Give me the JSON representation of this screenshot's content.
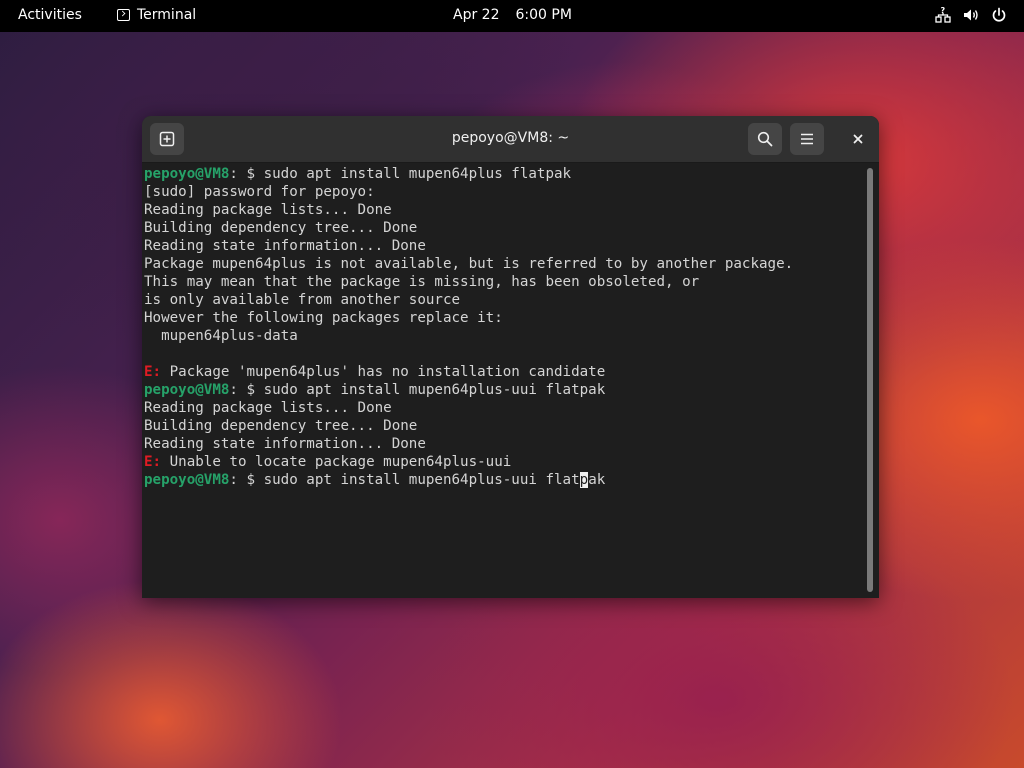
{
  "topbar": {
    "activities": "Activities",
    "app_name": "Terminal",
    "date": "Apr 22",
    "time": "6:00 PM",
    "icons": [
      "network-icon",
      "volume-icon",
      "power-icon"
    ]
  },
  "window": {
    "title": "pepoyo@VM8: ~"
  },
  "terminal": {
    "prompt_user": "pepoyo@VM8",
    "prompt_sep": ":",
    "prompt_tail": " $ ",
    "cmd1": "sudo apt install mupen64plus flatpak",
    "out1": [
      "[sudo] password for pepoyo:",
      "Reading package lists... Done",
      "Building dependency tree... Done",
      "Reading state information... Done",
      "Package mupen64plus is not available, but is referred to by another package.",
      "This may mean that the package is missing, has been obsoleted, or",
      "is only available from another source",
      "However the following packages replace it:",
      "  mupen64plus-data",
      ""
    ],
    "err_label": "E:",
    "err1": " Package 'mupen64plus' has no installation candidate",
    "cmd2": "sudo apt install mupen64plus-uui flatpak",
    "out2": [
      "Reading package lists... Done",
      "Building dependency tree... Done",
      "Reading state information... Done"
    ],
    "err2": " Unable to locate package mupen64plus-uui",
    "cmd3_before": "sudo apt install mupen64plus-uui flat",
    "cmd3_cursor": "p",
    "cmd3_after": "ak"
  },
  "colors": {
    "prompt": "#26a269",
    "error": "#e01b24",
    "text": "#d4d4d4",
    "background": "#1e1e1e"
  }
}
